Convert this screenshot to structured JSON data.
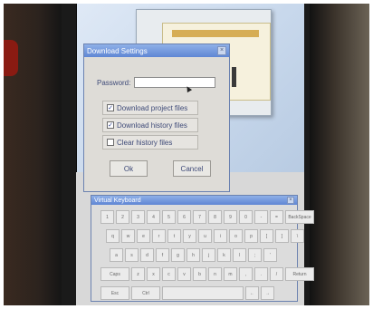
{
  "dialog": {
    "title": "Download Settings",
    "close_glyph": "×",
    "password_label": "Password:",
    "password_value": "",
    "options": [
      {
        "label": "Download project files",
        "checked": true
      },
      {
        "label": "Download history files",
        "checked": true
      },
      {
        "label": "Clear history files",
        "checked": false
      }
    ],
    "ok_label": "Ok",
    "cancel_label": "Cancel"
  },
  "keyboard": {
    "title": "Virtual Keyboard",
    "close_glyph": "×",
    "rows": [
      [
        "1",
        "2",
        "3",
        "4",
        "5",
        "6",
        "7",
        "8",
        "9",
        "0",
        "-",
        "=",
        "BackSpace"
      ],
      [
        "q",
        "w",
        "e",
        "r",
        "t",
        "y",
        "u",
        "i",
        "o",
        "p",
        "[",
        "]",
        "\\"
      ],
      [
        "a",
        "s",
        "d",
        "f",
        "g",
        "h",
        "j",
        "k",
        "l",
        ";",
        "'"
      ],
      [
        "Caps",
        "z",
        "x",
        "c",
        "v",
        "b",
        "n",
        "m",
        ",",
        ".",
        "/",
        "Return"
      ],
      [
        "Esc",
        "Ctrl",
        " ",
        "←",
        "→"
      ]
    ]
  }
}
